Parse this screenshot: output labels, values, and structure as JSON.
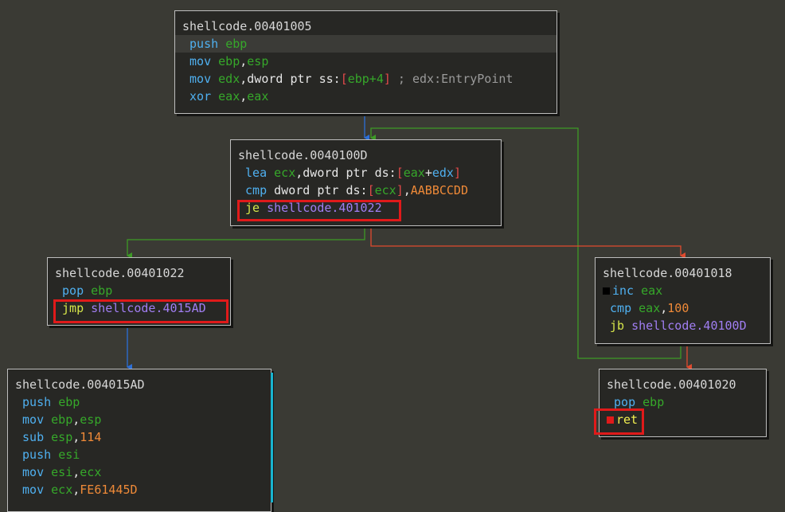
{
  "blocks": {
    "b1005": {
      "title": "shellcode.00401005",
      "lines": [
        {
          "mn": "push",
          "ops": [
            {
              "t": "ebp",
              "c": "reg"
            }
          ]
        },
        {
          "mn": "mov",
          "ops": [
            {
              "t": "ebp",
              "c": "reg"
            },
            {
              "t": ",",
              "c": "plain"
            },
            {
              "t": "esp",
              "c": "reg"
            }
          ]
        },
        {
          "mn": "mov",
          "ops": [
            {
              "t": "edx",
              "c": "reg"
            },
            {
              "t": ",dword ptr ss:",
              "c": "plain"
            },
            {
              "t": "[",
              "c": "br"
            },
            {
              "t": "ebp+4",
              "c": "reg"
            },
            {
              "t": "]",
              "c": "br"
            },
            {
              "t": " ; edx:EntryPoint",
              "c": "cmt"
            }
          ]
        },
        {
          "mn": "xor",
          "ops": [
            {
              "t": "eax",
              "c": "reg"
            },
            {
              "t": ",",
              "c": "plain"
            },
            {
              "t": "eax",
              "c": "reg"
            }
          ]
        }
      ]
    },
    "b100D": {
      "title": "shellcode.0040100D",
      "lines": [
        {
          "mn": "lea",
          "ops": [
            {
              "t": "ecx",
              "c": "reg"
            },
            {
              "t": ",dword ptr ds:",
              "c": "plain"
            },
            {
              "t": "[",
              "c": "br"
            },
            {
              "t": "eax",
              "c": "reg"
            },
            {
              "t": "+",
              "c": "plain"
            },
            {
              "t": "edx",
              "c": "mn"
            },
            {
              "t": "]",
              "c": "br"
            }
          ]
        },
        {
          "mn": "cmp",
          "ops": [
            {
              "t": "dword ptr ds:",
              "c": "plain"
            },
            {
              "t": "[",
              "c": "br"
            },
            {
              "t": "ecx",
              "c": "reg"
            },
            {
              "t": "]",
              "c": "br"
            },
            {
              "t": ",",
              "c": "plain"
            },
            {
              "t": "AABBCCDD",
              "c": "num"
            }
          ]
        },
        {
          "mn": "je",
          "mnClass": "jmp",
          "ops": [
            {
              "t": "shellcode.401022",
              "c": "tgt"
            }
          ]
        }
      ]
    },
    "b1022": {
      "title": "shellcode.00401022",
      "lines": [
        {
          "mn": "pop",
          "ops": [
            {
              "t": "ebp",
              "c": "reg"
            }
          ]
        },
        {
          "mn": "jmp",
          "mnClass": "jmp",
          "ops": [
            {
              "t": "shellcode.4015AD",
              "c": "tgt"
            }
          ]
        }
      ]
    },
    "b1018": {
      "title": "shellcode.00401018",
      "lines": [
        {
          "mn": "inc",
          "bp": "#000000",
          "ops": [
            {
              "t": "eax",
              "c": "reg"
            }
          ]
        },
        {
          "mn": "cmp",
          "ops": [
            {
              "t": "eax",
              "c": "reg"
            },
            {
              "t": ",",
              "c": "plain"
            },
            {
              "t": "100",
              "c": "num"
            }
          ]
        },
        {
          "mn": "jb",
          "mnClass": "jmp",
          "ops": [
            {
              "t": "shellcode.40100D",
              "c": "tgt"
            }
          ]
        }
      ]
    },
    "b15AD": {
      "title": "shellcode.004015AD",
      "lines": [
        {
          "mn": "push",
          "ops": [
            {
              "t": "ebp",
              "c": "reg"
            }
          ]
        },
        {
          "mn": "mov",
          "ops": [
            {
              "t": "ebp",
              "c": "reg"
            },
            {
              "t": ",",
              "c": "plain"
            },
            {
              "t": "esp",
              "c": "reg"
            }
          ]
        },
        {
          "mn": "sub",
          "ops": [
            {
              "t": "esp",
              "c": "reg"
            },
            {
              "t": ",",
              "c": "plain"
            },
            {
              "t": "114",
              "c": "num"
            }
          ]
        },
        {
          "mn": "push",
          "ops": [
            {
              "t": "esi",
              "c": "reg"
            }
          ]
        },
        {
          "mn": "mov",
          "ops": [
            {
              "t": "esi",
              "c": "reg"
            },
            {
              "t": ",",
              "c": "plain"
            },
            {
              "t": "ecx",
              "c": "reg"
            }
          ]
        },
        {
          "mn": "mov",
          "ops": [
            {
              "t": "ecx",
              "c": "reg"
            },
            {
              "t": ",",
              "c": "plain"
            },
            {
              "t": "FE61445D",
              "c": "num"
            }
          ]
        }
      ]
    },
    "b1020": {
      "title": "shellcode.00401020",
      "lines": [
        {
          "mn": "pop",
          "ops": [
            {
              "t": "ebp",
              "c": "reg"
            }
          ]
        },
        {
          "mn": "ret",
          "mnClass": "ret",
          "bp": "#e01a1a",
          "ops": []
        }
      ]
    }
  },
  "colors": {
    "background": "#3a3a34",
    "block_bg": "#272724",
    "edge_true": "#3d9a26",
    "edge_false": "#e04a2e",
    "edge_uncond": "#2c6fd8",
    "highlight": "#e01a1a"
  }
}
